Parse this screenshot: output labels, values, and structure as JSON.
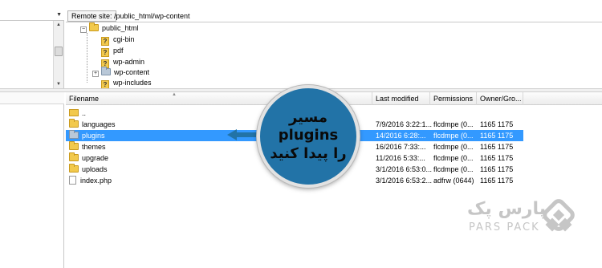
{
  "remote_site": {
    "label": "Remote site:",
    "path": "/public_html/wp-content"
  },
  "tree": {
    "root": {
      "label": "public_html",
      "expander": "−"
    },
    "items": [
      {
        "label": "cgi-bin",
        "icon": "unknown-folder-icon"
      },
      {
        "label": "pdf",
        "icon": "unknown-folder-icon"
      },
      {
        "label": "wp-admin",
        "icon": "unknown-folder-icon"
      },
      {
        "label": "wp-content",
        "icon": "folder-icon",
        "expander": "+"
      },
      {
        "label": "wp-includes",
        "icon": "unknown-folder-icon"
      }
    ]
  },
  "file_list": {
    "columns": {
      "filename": "Filename",
      "last_modified": "Last modified",
      "permissions": "Permissions",
      "owner": "Owner/Gro..."
    },
    "rows": [
      {
        "name": "..",
        "modified": "",
        "permissions": "",
        "owner": "",
        "icon": "parent-folder-icon",
        "selected": false
      },
      {
        "name": "languages",
        "modified": "7/9/2016 3:22:1...",
        "permissions": "flcdmpe (0...",
        "owner": "1165 1175",
        "icon": "folder-icon",
        "selected": false
      },
      {
        "name": "plugins",
        "modified": "14/2016 6:28:...",
        "permissions": "flcdmpe (0...",
        "owner": "1165 1175",
        "icon": "folder-icon",
        "selected": true
      },
      {
        "name": "themes",
        "modified": "16/2016 7:33:...",
        "permissions": "flcdmpe (0...",
        "owner": "1165 1175",
        "icon": "folder-icon",
        "selected": false
      },
      {
        "name": "upgrade",
        "modified": "11/2016 5:33:...",
        "permissions": "flcdmpe (0...",
        "owner": "1165 1175",
        "icon": "folder-icon",
        "selected": false
      },
      {
        "name": "uploads",
        "modified": "3/1/2016 6:53:0...",
        "permissions": "flcdmpe (0...",
        "owner": "1165 1175",
        "icon": "folder-icon",
        "selected": false
      },
      {
        "name": "index.php",
        "modified": "3/1/2016 6:53:2...",
        "permissions": "adfrw (0644)",
        "owner": "1165 1175",
        "icon": "file-icon",
        "selected": false
      }
    ]
  },
  "callout": {
    "line1": "مسیر plugins",
    "line2": "را پیدا کنید"
  },
  "logo": {
    "fa": "پارس پک",
    "en": "PARS PACK"
  },
  "colors": {
    "selection": "#3399ff",
    "callout_bg": "#2273a7",
    "folder": "#f2c94c",
    "logo": "#c6c6c6"
  }
}
